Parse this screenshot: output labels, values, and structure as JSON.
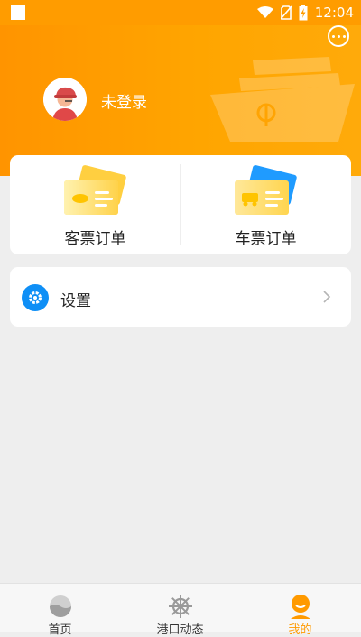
{
  "status_bar": {
    "time": "12:04"
  },
  "profile": {
    "login_status": "未登录"
  },
  "orders": [
    {
      "label": "客票订单",
      "icon": "passenger-ticket-icon",
      "color": "#ffb300"
    },
    {
      "label": "车票订单",
      "icon": "vehicle-ticket-icon",
      "color": "#1e90ff"
    }
  ],
  "settings": {
    "label": "设置",
    "icon": "gear-icon"
  },
  "bottom_nav": {
    "items": [
      {
        "label": "首页",
        "icon": "home-icon"
      },
      {
        "label": "港口动态",
        "icon": "ship-wheel-icon"
      },
      {
        "label": "我的",
        "icon": "profile-icon",
        "active": true
      }
    ]
  },
  "colors": {
    "accent": "#ff9c00",
    "active_nav": "#ff9a00",
    "settings_icon": "#0f8ff6"
  }
}
